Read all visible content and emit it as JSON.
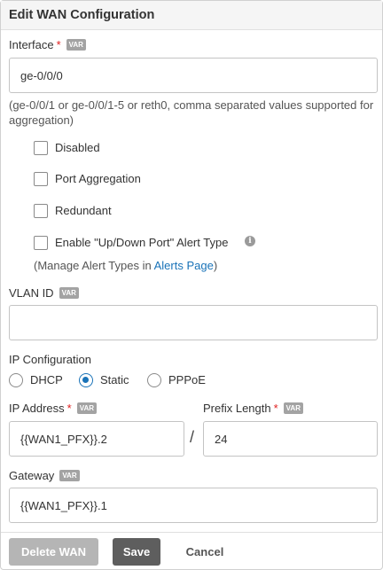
{
  "header": {
    "title": "Edit WAN Configuration"
  },
  "var_badge": "VAR",
  "required_mark": "*",
  "interface": {
    "label": "Interface",
    "value": "ge-0/0/0",
    "help": "(ge-0/0/1 or ge-0/0/1-5 or reth0, comma separated values supported for aggregation)"
  },
  "checkboxes": [
    {
      "label": "Disabled",
      "checked": false
    },
    {
      "label": "Port Aggregation",
      "checked": false
    },
    {
      "label": "Redundant",
      "checked": false
    },
    {
      "label": "Enable \"Up/Down Port\" Alert Type",
      "checked": false
    }
  ],
  "manage_alerts": {
    "prefix": "(Manage Alert Types in ",
    "link": "Alerts Page",
    "suffix": ")"
  },
  "vlan": {
    "label": "VLAN ID",
    "value": ""
  },
  "ip_config": {
    "label": "IP Configuration",
    "options": [
      "DHCP",
      "Static",
      "PPPoE"
    ],
    "selected": "Static"
  },
  "ip_address": {
    "label": "IP Address",
    "value": "{{WAN1_PFX}}.2"
  },
  "separator": "/",
  "prefix_length": {
    "label": "Prefix Length",
    "value": "24"
  },
  "gateway": {
    "label": "Gateway",
    "value": "{{WAN1_PFX}}.1"
  },
  "buttons": {
    "delete": "Delete WAN",
    "save": "Save",
    "cancel": "Cancel"
  },
  "colors": {
    "accent": "#1a73b8",
    "required": "#e02020",
    "save_bg": "#5e5e5e",
    "delete_bg": "#b5b5b5"
  },
  "icons": {
    "info": "info-circle-icon"
  }
}
